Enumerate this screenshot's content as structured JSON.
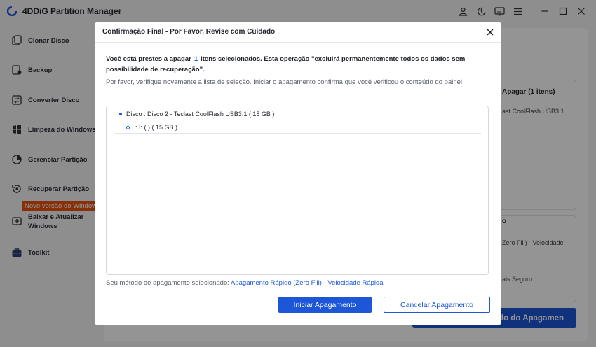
{
  "app": {
    "title": "4DDiG Partition Manager"
  },
  "titlebar_icons": [
    "user-icon",
    "theme-icon",
    "feedback-icon",
    "menu-icon",
    "minimize-icon",
    "maximize-icon",
    "close-icon"
  ],
  "sidebar": {
    "items": [
      {
        "label": "Clonar Disco",
        "icon": "clone-disk-icon"
      },
      {
        "label": "Backup",
        "icon": "backup-icon"
      },
      {
        "label": "Converter Disco",
        "icon": "convert-disk-icon"
      },
      {
        "label": "Limpeza do Windows",
        "icon": "windows-clean-icon"
      },
      {
        "label": "Gerenciar Partição",
        "icon": "partition-icon"
      },
      {
        "label": "Recuperar Partição",
        "icon": "recover-partition-icon"
      },
      {
        "label": "Baixar e Atualizar Windows",
        "icon": "download-windows-icon"
      },
      {
        "label": "Toolkit",
        "icon": "toolkit-icon"
      }
    ],
    "new_version_badge": "Novo versão do Windows"
  },
  "background": {
    "card1_title": "Apagar (1 itens)",
    "card1_line": "ast CoolFlash USB3.1",
    "card2_title": "o",
    "card2_line1": "Zero Fill) - Velocidade",
    "card2_line2": "ais Seguro",
    "action_button": "do do Apagamen"
  },
  "dialog": {
    "title": "Confirmação Final - Por Favor, Revise com Cuidado",
    "warning_prefix": "Você está prestes a apagar",
    "warning_count": "1",
    "warning_suffix": "itens selecionados. Esta operação \"excluirá permanentemente todos os dados sem possibilidade de recuperação\".",
    "hint": "Por favor, verifique novamente a lista de seleção. Iniciar o apagamento confirma que você verificou o conteúdo do painel.",
    "disk_label": "Disco : Disco 2 - Teclast CoolFlash USB3.1 ( 15 GB )",
    "partition_label": ":  I: (  ) ( 15 GB )",
    "method_prefix": "Seu método de apagamento selecionado:",
    "method_value": "Apagamento Rápido (Zero Fill) - Velocidade Rápida",
    "start_button": "Iniciar Apagamento",
    "cancel_button": "Cancelar Apagamento"
  },
  "colors": {
    "accent": "#1d57d8",
    "badge": "#e8540f"
  }
}
